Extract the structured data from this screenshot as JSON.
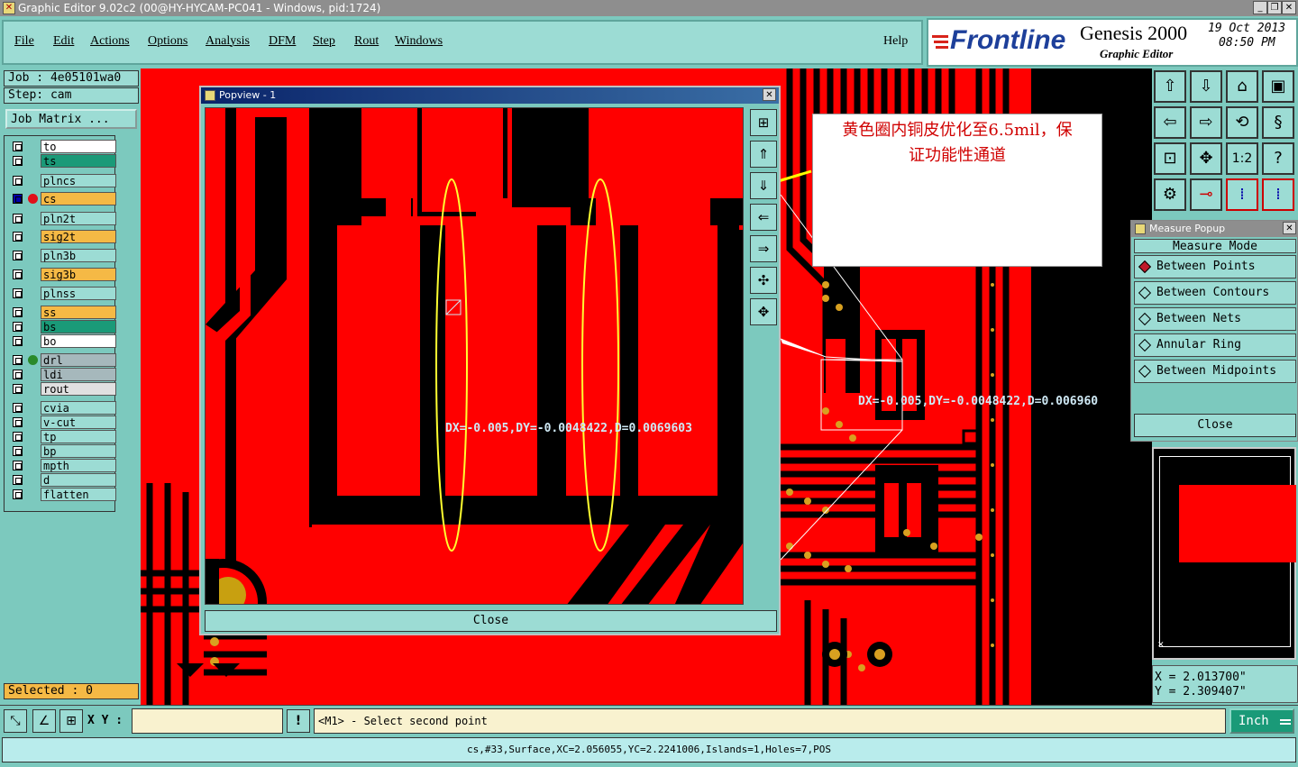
{
  "window": {
    "title": "Graphic Editor 9.02c2 (00@HY-HYCAM-PC041 - Windows, pid:1724)"
  },
  "menu": {
    "items": [
      "File",
      "Edit",
      "Actions",
      "Options",
      "Analysis",
      "DFM",
      "Step",
      "Rout",
      "Windows"
    ],
    "help": "Help"
  },
  "brand": {
    "logo": "Frontline",
    "product": "Genesis 2000",
    "subtitle": "Graphic Editor",
    "date": "19 Oct 2013",
    "time": "08:50 PM"
  },
  "job": {
    "job_label": "Job : 4e05101wa0",
    "step_label": "Step: cam",
    "matrix_button": "Job Matrix ...",
    "selected": "Selected : 0"
  },
  "layers": [
    {
      "name": "to",
      "color": "#ffffff"
    },
    {
      "name": "ts",
      "color": "#1a9a78"
    },
    {
      "name": "plncs",
      "color": "#9cdcd4"
    },
    {
      "name": "cs",
      "color": "#f5b945",
      "active": true
    },
    {
      "name": "pln2t",
      "color": "#9cdcd4"
    },
    {
      "name": "sig2t",
      "color": "#f5b945"
    },
    {
      "name": "pln3b",
      "color": "#9cdcd4"
    },
    {
      "name": "sig3b",
      "color": "#f5b945"
    },
    {
      "name": "plnss",
      "color": "#9cdcd4"
    },
    {
      "name": "ss",
      "color": "#f5b945"
    },
    {
      "name": "bs",
      "color": "#1a9a78"
    },
    {
      "name": "bo",
      "color": "#ffffff"
    },
    {
      "name": "drl",
      "color": "#a6b8bc",
      "dot": "#2a8a2a"
    },
    {
      "name": "ldi",
      "color": "#a6b8bc"
    },
    {
      "name": "rout",
      "color": "#e0e0e0"
    },
    {
      "name": "cvia",
      "color": "#9cdcd4"
    },
    {
      "name": "v-cut",
      "color": "#9cdcd4"
    },
    {
      "name": "tp",
      "color": "#9cdcd4"
    },
    {
      "name": "bp",
      "color": "#9cdcd4"
    },
    {
      "name": "mpth",
      "color": "#9cdcd4"
    },
    {
      "name": "d",
      "color": "#9cdcd4"
    },
    {
      "name": "flatten",
      "color": "#9cdcd4"
    }
  ],
  "popview": {
    "title": "Popview - 1",
    "measure_text": "DX=-0.005,DY=-0.0048422,D=0.0069603",
    "close": "Close"
  },
  "main_measure_text": "DX=-0.005,DY=-0.0048422,D=0.006960",
  "annotation": {
    "line1": "黄色圈内铜皮优化至6.5mil，保",
    "line2": "证功能性通道"
  },
  "measure_popup": {
    "title": "Measure Popup",
    "header": "Measure Mode",
    "options": [
      "Between Points",
      "Between Contours",
      "Between Nets",
      "Annular Ring",
      "Between Midpoints"
    ],
    "selected_index": 0,
    "close": "Close"
  },
  "coords": {
    "x": "X = 2.013700\"",
    "y": "Y = 2.309407\""
  },
  "bottom": {
    "xy_label": "X Y :",
    "xy_value": "",
    "prompt": "<M1> - Select second point",
    "units": "Inch"
  },
  "status": "cs,#33,Surface,XC=2.056055,YC=2.2241006,Islands=1,Holes=7,POS",
  "toolbar": {
    "zoom_label": "1:2"
  }
}
